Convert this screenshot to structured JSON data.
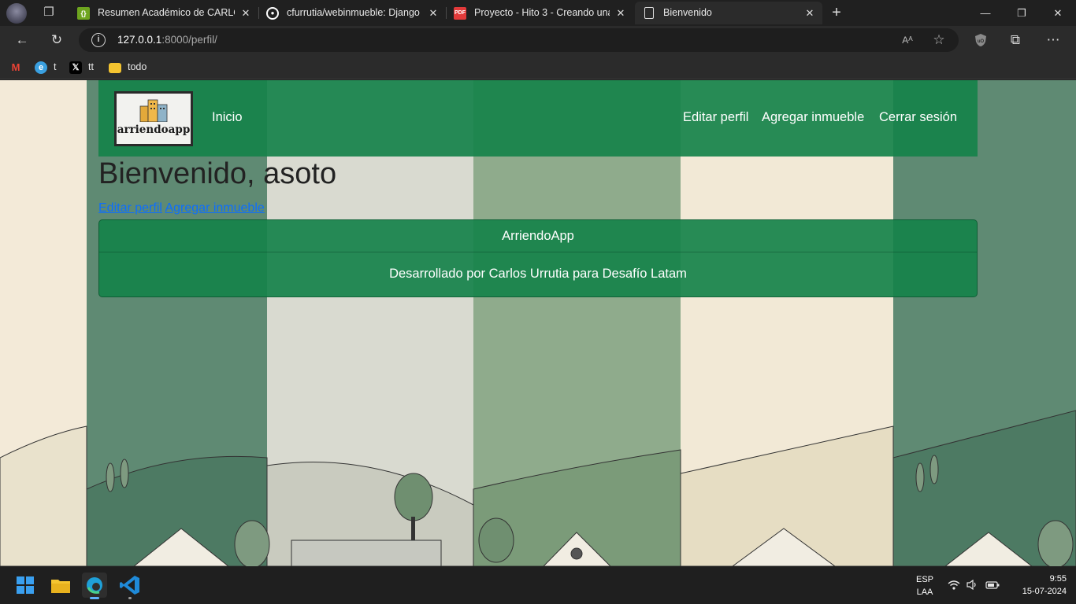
{
  "browser": {
    "tabs": [
      {
        "title": "Resumen Académico de CARLOS",
        "favicon": "code-braces-icon",
        "active": false
      },
      {
        "title": "cfurrutia/webinmueble: Django y",
        "favicon": "github-icon",
        "active": false
      },
      {
        "title": "Proyecto - Hito 3 - Creando una",
        "favicon": "pdf-icon",
        "active": false
      },
      {
        "title": "Bienvenido",
        "favicon": "page-icon",
        "active": true
      }
    ],
    "url": {
      "host": "127.0.0.1",
      "path": ":8000/perfil/"
    },
    "bookmarks": [
      {
        "label": "",
        "icon": "gmail-icon"
      },
      {
        "label": "t",
        "icon": "edge-tab-icon"
      },
      {
        "label": "tt",
        "icon": "x-icon"
      },
      {
        "label": "todo",
        "icon": "folder-icon"
      }
    ]
  },
  "page": {
    "logo_text": "arriendoapp",
    "nav": {
      "home": "Inicio",
      "edit_profile": "Editar perfil",
      "add_property": "Agregar inmueble",
      "logout": "Cerrar sesión"
    },
    "heading": "Bienvenido, asoto",
    "links": {
      "edit_profile": "Editar perfil",
      "add_property": "Agregar inmueble"
    },
    "footer": {
      "header": "ArriendoApp",
      "body": "Desarrollado por Carlos Urrutia para Desafío Latam"
    }
  },
  "taskbar": {
    "lang_top": "ESP",
    "lang_bottom": "LAA",
    "time": "9:55",
    "date": "15-07-2024"
  },
  "colors": {
    "navbar": "#16824a",
    "link": "#0d6efd",
    "browser_dark": "#202020"
  }
}
